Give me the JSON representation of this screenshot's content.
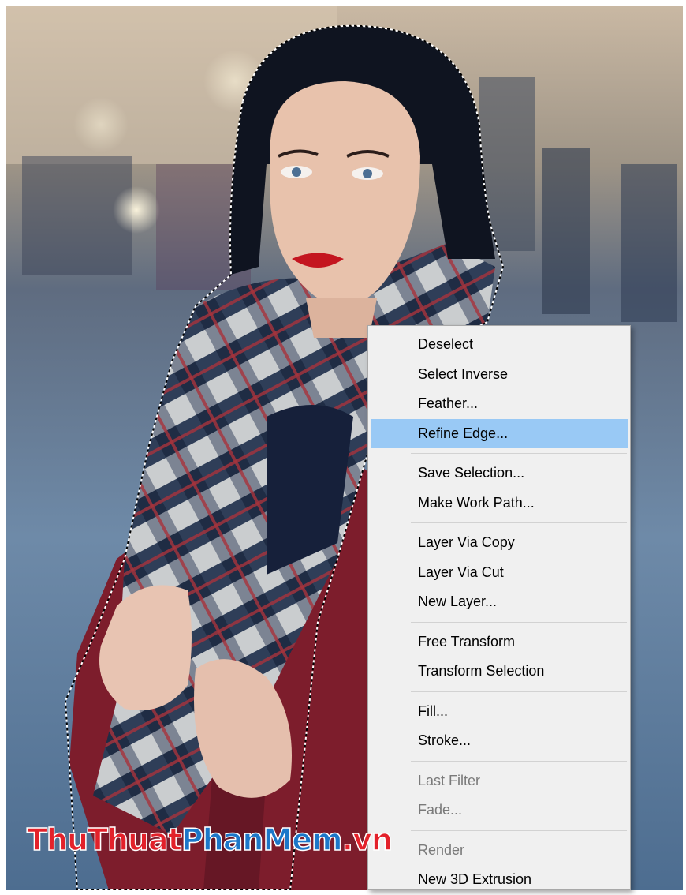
{
  "context_menu": {
    "groups": [
      [
        {
          "label": "Deselect"
        },
        {
          "label": "Select Inverse"
        },
        {
          "label": "Feather..."
        },
        {
          "label": "Refine Edge...",
          "state": "highlighted"
        }
      ],
      [
        {
          "label": "Save Selection..."
        },
        {
          "label": "Make Work Path..."
        }
      ],
      [
        {
          "label": "Layer Via Copy"
        },
        {
          "label": "Layer Via Cut"
        },
        {
          "label": "New Layer..."
        }
      ],
      [
        {
          "label": "Free Transform"
        },
        {
          "label": "Transform Selection"
        }
      ],
      [
        {
          "label": "Fill..."
        },
        {
          "label": "Stroke..."
        }
      ],
      [
        {
          "label": "Last Filter",
          "state": "disabled"
        },
        {
          "label": "Fade...",
          "state": "disabled"
        }
      ],
      [
        {
          "label": "Render",
          "state": "disabled"
        },
        {
          "label": "New 3D Extrusion"
        }
      ]
    ],
    "highlight_color": "#99c9f5",
    "background_color": "#f0f0f0"
  },
  "watermark": {
    "part1": "ThuThuat",
    "part2": "PhanMem",
    "part3": ".vn",
    "color1": "#e3212a",
    "color2": "#1c77c9"
  },
  "photo": {
    "subject": "woman-portrait-with-plaid-scarf",
    "selection": "marching-ants-around-subject"
  }
}
